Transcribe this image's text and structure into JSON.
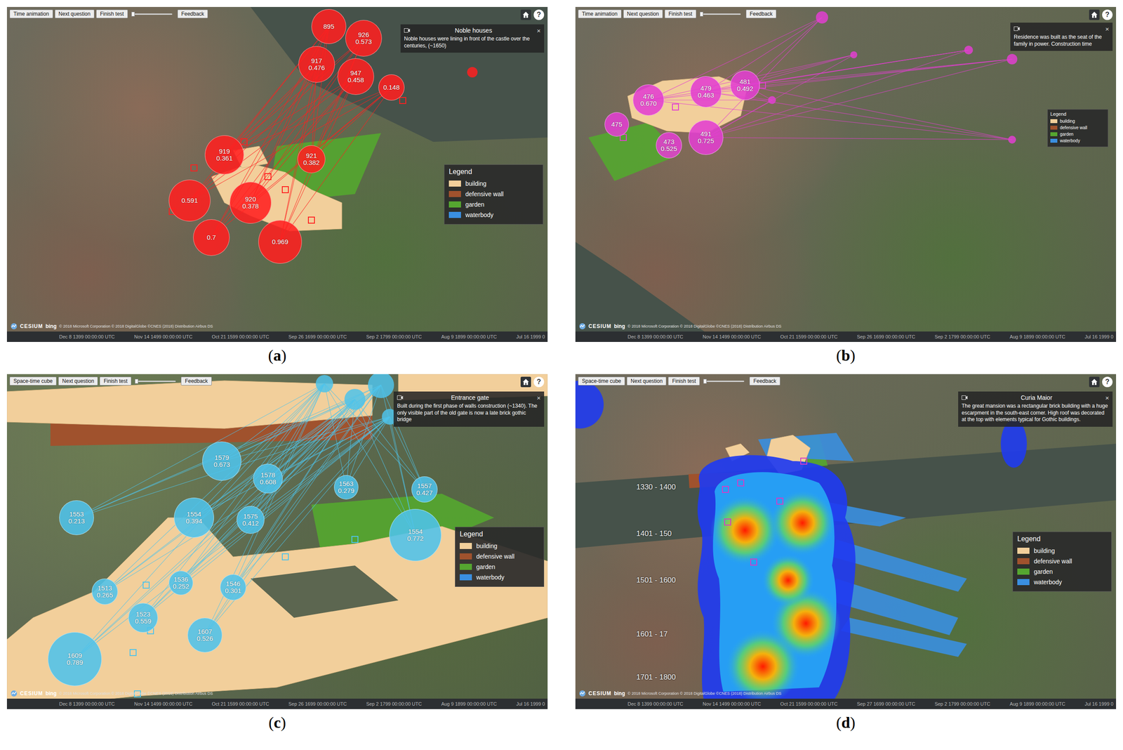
{
  "figure": {
    "panels": [
      {
        "caption": [
          "(",
          "a",
          ")"
        ],
        "color": "#ff2020",
        "toolbar": {
          "buttons": [
            "Time animation",
            "Next question",
            "Finish test"
          ],
          "slider": {
            "level": 0
          },
          "feedback": "Feedback"
        },
        "help": "?",
        "popup": {
          "title": "Noble houses",
          "close": "×",
          "text": "Noble houses were lining in front of the castle over the centuries, (~1650)"
        },
        "bubbles": [
          {
            "labels": [
              "895"
            ]
          },
          {
            "labels": [
              "926",
              "0.573"
            ]
          },
          {
            "labels": [
              "917",
              "0.476"
            ]
          },
          {
            "labels": [
              "947",
              "0.458"
            ]
          },
          {
            "labels": [
              "0.148"
            ]
          },
          {
            "labels": [
              "919",
              "0.361"
            ]
          },
          {
            "labels": [
              "0.591"
            ]
          },
          {
            "labels": [
              "920",
              "0.378"
            ]
          },
          {
            "labels": [
              "0.7"
            ]
          },
          {
            "labels": [
              "0.969"
            ]
          },
          {
            "labels": [
              "921",
              "0.382"
            ]
          }
        ],
        "periods": [],
        "legend": {
          "title": "Legend",
          "items": [
            {
              "label": "building",
              "color": "#f2cf9b"
            },
            {
              "label": "defensive wall",
              "color": "#a0522d"
            },
            {
              "label": "garden",
              "color": "#55a630"
            },
            {
              "label": "waterbody",
              "color": "#3a8fe0"
            }
          ]
        },
        "attribution": {
          "logo": "CESIUM",
          "provider": "bing",
          "credits": "© 2018 Microsoft Corporation © 2018 DigitalGlobe ©CNES (2018) Distribution Airbus DS"
        },
        "timeline": [
          "Dec 8 1399 00:00:00 UTC",
          "Nov 14 1499 00:00:00 UTC",
          "Oct 21 1599 00:00:00 UTC",
          "Sep 26 1699 00:00:00 UTC",
          "Sep 2 1799 00:00:00 UTC",
          "Aug 9 1899 00:00:00 UTC",
          "Jul 16 1999 0"
        ]
      },
      {
        "caption": [
          "(",
          "b",
          ")"
        ],
        "color": "#e23fd0",
        "toolbar": {
          "buttons": [
            "Time animation",
            "Next question",
            "Finish test"
          ],
          "slider": {
            "level": 0
          },
          "feedback": "Feedback"
        },
        "help": "?",
        "popup": {
          "title": "",
          "close": "×",
          "text": "Residence was built as the seat of the family in power. Construction time"
        },
        "bubbles": [
          {
            "labels": [
              "476",
              "0.670"
            ]
          },
          {
            "labels": [
              "479",
              "0.463"
            ]
          },
          {
            "labels": [
              "481",
              "0.492"
            ]
          },
          {
            "labels": [
              "475"
            ]
          },
          {
            "labels": [
              "473",
              "0.525"
            ]
          },
          {
            "labels": [
              "491",
              "0.725"
            ]
          }
        ],
        "periods": [],
        "legend": {
          "title": "Legend",
          "items": [
            {
              "label": "building",
              "color": "#f2cf9b"
            },
            {
              "label": "defensive wall",
              "color": "#a0522d"
            },
            {
              "label": "garden",
              "color": "#55a630"
            },
            {
              "label": "waterbody",
              "color": "#3a8fe0"
            }
          ]
        },
        "attribution": {
          "logo": "CESIUM",
          "provider": "bing",
          "credits": "© 2018 Microsoft Corporation © 2018 DigitalGlobe ©CNES (2018) Distribution Airbus DS"
        },
        "timeline": [
          "Dec 8 1399 00:00:00 UTC",
          "Nov 14 1499 00:00:00 UTC",
          "Oct 21 1599 00:00:00 UTC",
          "Sep 26 1699 00:00:00 UTC",
          "Sep 2 1799 00:00:00 UTC",
          "Aug 9 1899 00:00:00 UTC",
          "Jul 16 1999 0"
        ]
      },
      {
        "caption": [
          "(",
          "c",
          ")"
        ],
        "color": "#4fc3ea",
        "toolbar": {
          "buttons": [
            "Space-time cube",
            "Next question",
            "Finish test"
          ],
          "slider": {
            "level": 0
          },
          "feedback": "Feedback"
        },
        "help": "?",
        "popup": {
          "title": "Entrance gate",
          "close": "×",
          "text": "Built during the first phase of walls construction (~1340). The only visible part of the old gate is now a late brick gothic bridge"
        },
        "bubbles": [
          {
            "labels": [
              "1579",
              "0.673"
            ]
          },
          {
            "labels": [
              "1578",
              "0.608"
            ]
          },
          {
            "labels": [
              "1554",
              "0.394"
            ]
          },
          {
            "labels": [
              "1575",
              "0.412"
            ]
          },
          {
            "labels": [
              "1553",
              "0.213"
            ]
          },
          {
            "labels": [
              "1554",
              "0.772"
            ]
          },
          {
            "labels": [
              "1557",
              "0.427"
            ]
          },
          {
            "labels": [
              "1609",
              "0.789"
            ]
          },
          {
            "labels": [
              "1523",
              "0.559"
            ]
          },
          {
            "labels": [
              "1513",
              "0.265"
            ]
          },
          {
            "labels": [
              "1607",
              "0.526"
            ]
          },
          {
            "labels": [
              "1536",
              "0.252"
            ]
          },
          {
            "labels": [
              "1546",
              "0.301"
            ]
          },
          {
            "labels": [
              "1563",
              "0.279"
            ]
          }
        ],
        "periods": [],
        "legend": {
          "title": "Legend",
          "items": [
            {
              "label": "building",
              "color": "#f2cf9b"
            },
            {
              "label": "defensive wall",
              "color": "#a0522d"
            },
            {
              "label": "garden",
              "color": "#55a630"
            },
            {
              "label": "waterbody",
              "color": "#3a8fe0"
            }
          ]
        },
        "attribution": {
          "logo": "CESIUM",
          "provider": "bing",
          "credits": "© 2018 Microsoft Corporation © 2018 DigitalGlobe ©CNES (2018) Distribution Airbus DS"
        },
        "timeline": [
          "Dec 8 1399 00:00:00 UTC",
          "Nov 14 1499 00:00:00 UTC",
          "Oct 21 1599 00:00:00 UTC",
          "Sep 26 1699 00:00:00 UTC",
          "Sep 2 1799 00:00:00 UTC",
          "Aug 9 1899 00:00:00 UTC",
          "Jul 16 1999 0"
        ]
      },
      {
        "caption": [
          "(",
          "d",
          ")"
        ],
        "color": "#d63bc7",
        "toolbar": {
          "buttons": [
            "Space-time cube",
            "Next question",
            "Finish test"
          ],
          "slider": {
            "level": 0
          },
          "feedback": "Feedback"
        },
        "help": "?",
        "popup": {
          "title": "Curia Maior",
          "close": "×",
          "text": "The great mansion was a rectangular brick building with a huge escarpment in the south-east corner. High roof was decorated at the top with elements typical for Gothic buildings."
        },
        "bubbles": [],
        "periods": [
          "1330 - 1400",
          "1401 - 150",
          "1501 - 1600",
          "1601 - 17",
          "1701 - 1800"
        ],
        "legend": {
          "title": "Legend",
          "items": [
            {
              "label": "building",
              "color": "#f2cf9b"
            },
            {
              "label": "defensive wall",
              "color": "#a0522d"
            },
            {
              "label": "garden",
              "color": "#55a630"
            },
            {
              "label": "waterbody",
              "color": "#3a8fe0"
            }
          ]
        },
        "attribution": {
          "logo": "CESIUM",
          "provider": "bing",
          "credits": "© 2018 Microsoft Corporation © 2018 DigitalGlobe ©CNES (2018) Distribution Airbus DS"
        },
        "timeline": [
          "Dec 8 1399 00:00:00 UTC",
          "Nov 14 1499 00:00:00 UTC",
          "Oct 21 1599 00:00:00 UTC",
          "Sep 27 1699 00:00:00 UTC",
          "Sep 2 1799 00:00:00 UTC",
          "Aug 9 1899 00:00:00 UTC",
          "Jul 16 1999 0"
        ]
      }
    ]
  }
}
